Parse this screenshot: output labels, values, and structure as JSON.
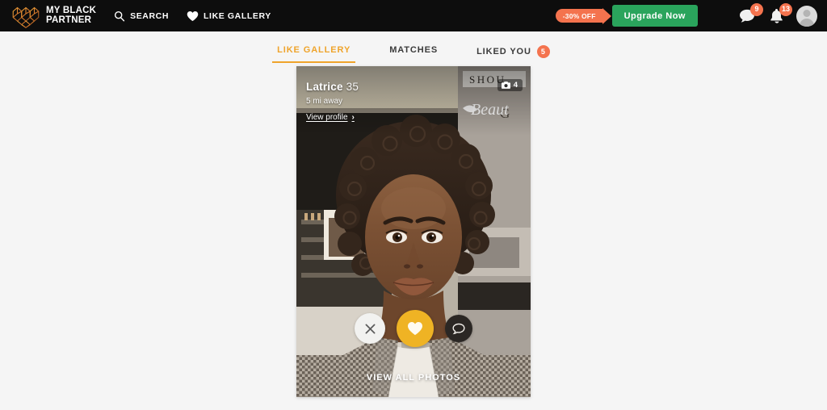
{
  "brand": {
    "line1": "MY BLACK",
    "line2": "PARTNER",
    "logo_icon": "geometric-heart-cubes-logo",
    "accent": "#e08a2e"
  },
  "nav": {
    "links": [
      {
        "label": "Search",
        "icon": "search-icon"
      },
      {
        "label": "Like Gallery",
        "icon": "heart-icon"
      }
    ]
  },
  "header_actions": {
    "promo": {
      "label": "-30% OFF",
      "color": "#f4734e"
    },
    "upgrade": {
      "label": "Upgrade Now",
      "color": "#2aa45c"
    },
    "messages": {
      "icon": "chat-bubble-icon",
      "count": "9"
    },
    "notifications": {
      "icon": "bell-icon",
      "count": "13"
    },
    "avatar": {
      "icon": "user-avatar-icon"
    }
  },
  "tabs": [
    {
      "label": "Like Gallery",
      "active": true,
      "badge": null
    },
    {
      "label": "Matches",
      "active": false,
      "badge": null
    },
    {
      "label": "Liked You",
      "active": false,
      "badge": "5"
    }
  ],
  "profile_card": {
    "name": "Latrice",
    "age": "35",
    "distance": "5 mi away",
    "view_profile": "View profile",
    "chevron": "›",
    "photo_count": "4",
    "camera_icon": "camera-icon",
    "view_all_photos": "View All Photos",
    "actions": {
      "pass": {
        "icon": "close-x-icon",
        "color": "#f2f2f0"
      },
      "like": {
        "icon": "heart-icon",
        "color": "#efb324"
      },
      "chat": {
        "icon": "chat-bubble-icon",
        "color": "#2b2724"
      }
    }
  },
  "theme": {
    "page_bg": "#f5f5f5",
    "topbar_bg": "#0d0d0d",
    "tab_active": "#efa42b",
    "badge": "#f4734e"
  }
}
